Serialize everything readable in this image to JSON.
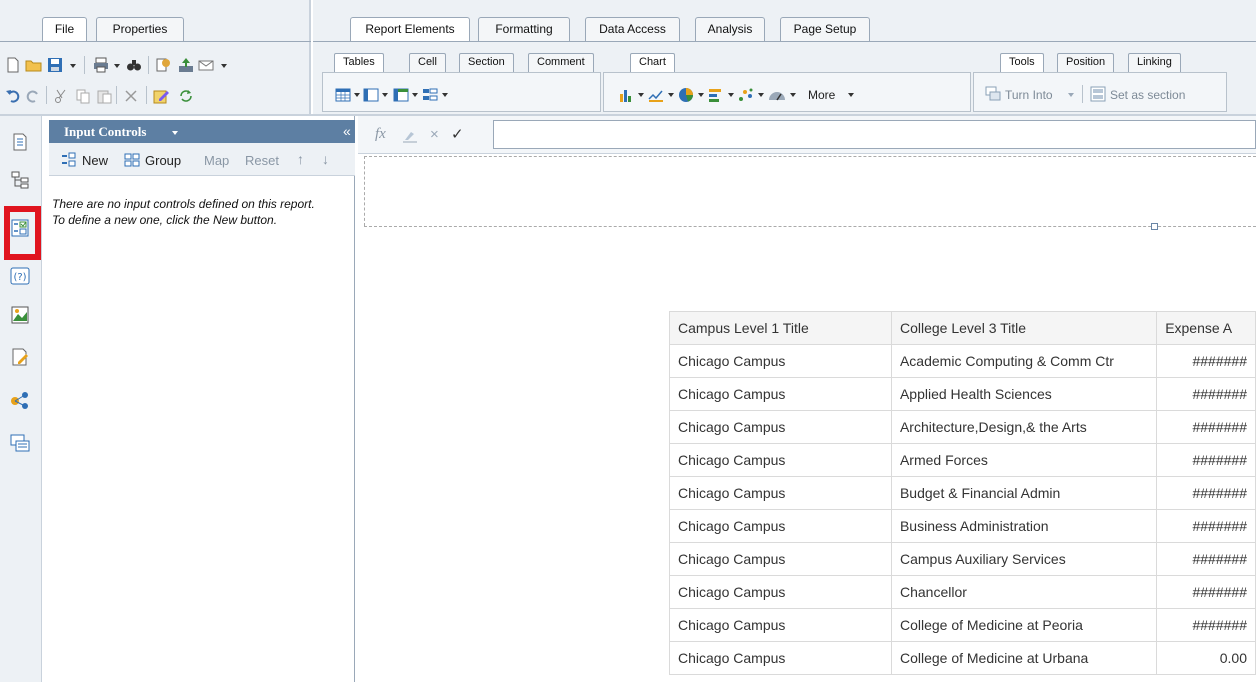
{
  "top_tabs_left": [
    {
      "label": "File",
      "active": true
    },
    {
      "label": "Properties",
      "active": false
    }
  ],
  "top_tabs_right": [
    {
      "label": "Report Elements",
      "active": true
    },
    {
      "label": "Formatting",
      "active": false
    },
    {
      "label": "Data Access",
      "active": false
    },
    {
      "label": "Analysis",
      "active": false
    },
    {
      "label": "Page Setup",
      "active": false
    }
  ],
  "sub_tabs": {
    "tables": "Tables",
    "cell": "Cell",
    "section": "Section",
    "comment": "Comment",
    "chart": "Chart",
    "tools": "Tools",
    "position": "Position",
    "linking": "Linking"
  },
  "toolbar": {
    "more_label": "More",
    "turn_into_label": "Turn Into",
    "set_as_section_label": "Set as section"
  },
  "input_controls": {
    "title": "Input Controls",
    "new_label": "New",
    "group_label": "Group",
    "map_label": "Map",
    "reset_label": "Reset",
    "empty_line1": "There are no input controls defined on this report.",
    "empty_line2": "To define a new one, click the New button."
  },
  "highlight_color": "#e0141e",
  "table": {
    "headers": [
      "Campus Level 1 Title",
      "College Level 3 Title",
      "Expense A"
    ],
    "rows": [
      [
        "Chicago Campus",
        "Academic Computing & Comm Ctr",
        "#######"
      ],
      [
        "Chicago Campus",
        "Applied Health Sciences",
        "#######"
      ],
      [
        "Chicago Campus",
        "Architecture,Design,& the Arts",
        "#######"
      ],
      [
        "Chicago Campus",
        "Armed Forces",
        "#######"
      ],
      [
        "Chicago Campus",
        "Budget & Financial Admin",
        "#######"
      ],
      [
        "Chicago Campus",
        "Business Administration",
        "#######"
      ],
      [
        "Chicago Campus",
        "Campus Auxiliary Services",
        "#######"
      ],
      [
        "Chicago Campus",
        "Chancellor",
        "#######"
      ],
      [
        "Chicago Campus",
        "College of Medicine at Peoria",
        "#######"
      ],
      [
        "Chicago Campus",
        "College of Medicine at Urbana",
        "0.00"
      ]
    ]
  }
}
